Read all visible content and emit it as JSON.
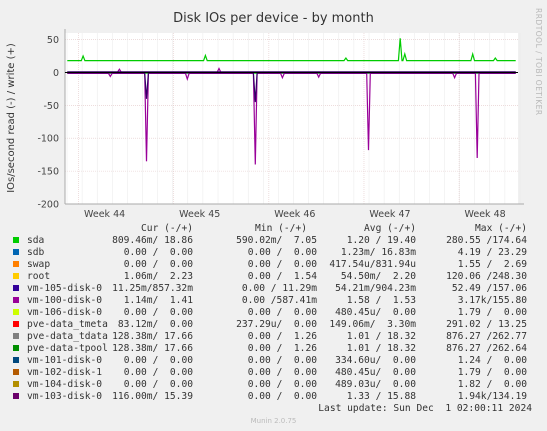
{
  "title": "Disk IOs per device - by month",
  "side_label": "RRDTOOL / TOBI OETIKER",
  "chart_data": {
    "type": "line",
    "title": "Disk IOs per device - by month",
    "ylabel": "IOs/second read (-) / write (+)",
    "ylim": [
      -200,
      60
    ],
    "yticks": [
      50,
      0,
      -50,
      -100,
      -150,
      -200
    ],
    "xticks": [
      "Week 44",
      "Week 45",
      "Week 46",
      "Week 47",
      "Week 48"
    ],
    "grid": true,
    "series": [
      {
        "name": "sda",
        "color": "#00cc00",
        "write_baseline": 18,
        "read_baseline": -1,
        "write_spikes": [
          [
            0.04,
            25
          ],
          [
            0.31,
            26
          ],
          [
            0.62,
            22
          ],
          [
            0.74,
            52
          ],
          [
            0.75,
            28
          ],
          [
            0.9,
            28
          ],
          [
            0.95,
            22
          ]
        ],
        "read_spikes": []
      },
      {
        "name": "vm-100-disk-0",
        "color": "#990099",
        "write_baseline": 0.5,
        "read_baseline": -1.5,
        "write_spikes": [
          [
            0.12,
            5
          ],
          [
            0.34,
            6
          ]
        ],
        "read_spikes": [
          [
            0.18,
            -135
          ],
          [
            0.42,
            -140
          ],
          [
            0.67,
            -118
          ],
          [
            0.91,
            -130
          ],
          [
            0.1,
            -6
          ],
          [
            0.27,
            -10
          ],
          [
            0.48,
            -8
          ],
          [
            0.56,
            -7
          ],
          [
            0.86,
            -8
          ]
        ]
      },
      {
        "name": "vm-103-disk-0",
        "color": "#330066",
        "write_baseline": 1,
        "read_baseline": -0.5,
        "write_spikes": [],
        "read_spikes": [
          [
            0.18,
            -40
          ],
          [
            0.42,
            -45
          ]
        ]
      }
    ]
  },
  "legend": {
    "headers": {
      "cur": "Cur (-/+)",
      "min": "Min (-/+)",
      "avg": "Avg (-/+)",
      "max": "Max (-/+)"
    },
    "rows": [
      {
        "name": "sda",
        "color": "#00cc00",
        "cur": "809.46m/ 18.86",
        "min": "590.02m/  7.05",
        "avg": "1.20 / 19.40",
        "max": "280.55 /174.64"
      },
      {
        "name": "sdb",
        "color": "#0066b3",
        "cur": "0.00 /  0.00",
        "min": "0.00 /  0.00",
        "avg": "1.23m/ 16.83m",
        "max": "4.19 / 23.29"
      },
      {
        "name": "swap",
        "color": "#ff8000",
        "cur": "0.00 /  0.00",
        "min": "0.00 /  0.00",
        "avg": "417.54u/831.94u",
        "max": "1.55 /  2.69"
      },
      {
        "name": "root",
        "color": "#ffcc00",
        "cur": "1.06m/  2.23",
        "min": "0.00 /  1.54",
        "avg": "54.50m/  2.20",
        "max": "120.06 /248.30"
      },
      {
        "name": "vm-105-disk-0",
        "color": "#330099",
        "cur": "11.25m/857.32m",
        "min": "0.00 / 11.29m",
        "avg": "54.21m/904.23m",
        "max": "52.49 /157.06"
      },
      {
        "name": "vm-100-disk-0",
        "color": "#990099",
        "cur": "1.14m/  1.41",
        "min": "0.00 /587.41m",
        "avg": "1.58 /  1.53",
        "max": "3.17k/155.80"
      },
      {
        "name": "vm-106-disk-0",
        "color": "#ccff00",
        "cur": "0.00 /  0.00",
        "min": "0.00 /  0.00",
        "avg": "480.45u/  0.00",
        "max": "1.79 /  0.00"
      },
      {
        "name": "pve-data_tmeta",
        "color": "#ff0000",
        "cur": "83.12m/  0.00",
        "min": "237.29u/  0.00",
        "avg": "149.06m/  3.30m",
        "max": "291.02 / 13.25"
      },
      {
        "name": "pve-data_tdata",
        "color": "#808080",
        "cur": "128.38m/ 17.66",
        "min": "0.00 /  1.26",
        "avg": "1.01 / 18.32",
        "max": "876.27 /262.77"
      },
      {
        "name": "pve-data-tpool",
        "color": "#008f00",
        "cur": "128.38m/ 17.66",
        "min": "0.00 /  1.26",
        "avg": "1.01 / 18.32",
        "max": "876.27 /262.64"
      },
      {
        "name": "vm-101-disk-0",
        "color": "#00487d",
        "cur": "0.00 /  0.00",
        "min": "0.00 /  0.00",
        "avg": "334.60u/  0.00",
        "max": "1.24 /  0.00"
      },
      {
        "name": "vm-102-disk-1",
        "color": "#b35a00",
        "cur": "0.00 /  0.00",
        "min": "0.00 /  0.00",
        "avg": "480.45u/  0.00",
        "max": "1.79 /  0.00"
      },
      {
        "name": "vm-104-disk-0",
        "color": "#b38f00",
        "cur": "0.00 /  0.00",
        "min": "0.00 /  0.00",
        "avg": "489.03u/  0.00",
        "max": "1.82 /  0.00"
      },
      {
        "name": "vm-103-disk-0",
        "color": "#6b006b",
        "cur": "116.00m/ 15.39",
        "min": "0.00 /  0.00",
        "avg": "1.33 / 15.88",
        "max": "1.94k/134.19"
      }
    ]
  },
  "last_update": "Last update: Sun Dec  1 02:00:11 2024",
  "footer": "Munin 2.0.75"
}
